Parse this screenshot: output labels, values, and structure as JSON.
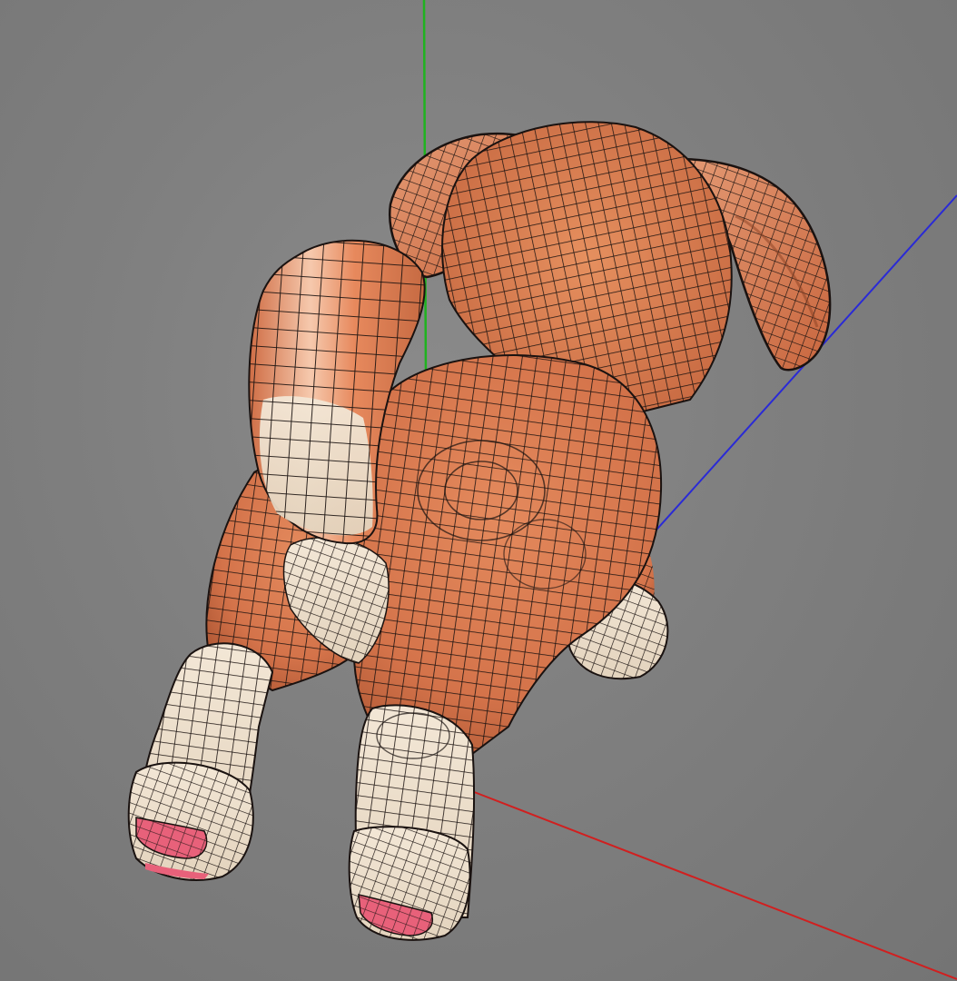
{
  "viewport": {
    "background_color": "#7c7c7c",
    "projection": "perspective"
  },
  "axes": {
    "x": {
      "color": "#d11f1f"
    },
    "y": {
      "color": "#1fb31f"
    },
    "z": {
      "color": "#2a2ad6"
    }
  },
  "model": {
    "name": "",
    "display_mode": "shaded-wireframe",
    "colors": {
      "fur": "#d9794f",
      "fur_highlight": "#f0a07a",
      "belly": "#efe2cf",
      "paw_pad": "#e8617a",
      "wire": "#1a1210"
    }
  }
}
